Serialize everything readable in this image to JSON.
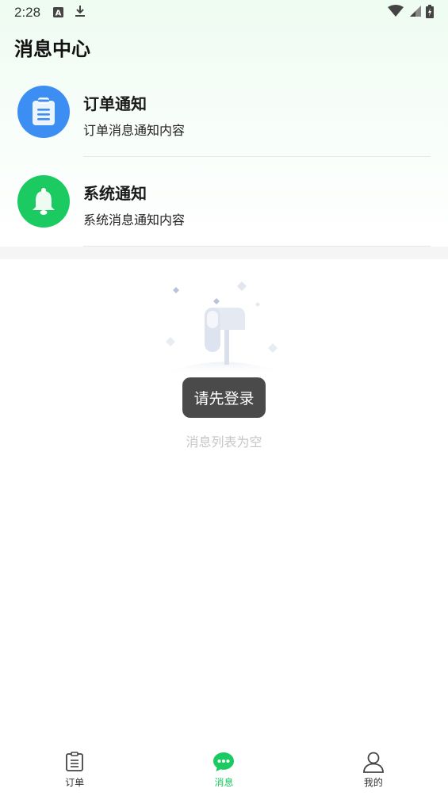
{
  "status_bar": {
    "time": "2:28",
    "left_icons": [
      "text-a-icon",
      "download-icon"
    ],
    "right_icons": [
      "wifi-icon",
      "signal-icon",
      "battery-icon"
    ]
  },
  "header": {
    "title": "消息中心"
  },
  "notices": [
    {
      "title": "订单通知",
      "description": "订单消息通知内容",
      "icon": "clipboard-icon",
      "color": "#3c8ef3"
    },
    {
      "title": "系统通知",
      "description": "系统消息通知内容",
      "icon": "bell-icon",
      "color": "#1bcb62"
    }
  ],
  "toast": {
    "text": "请先登录"
  },
  "empty_state": {
    "text": "消息列表为空",
    "icon": "mailbox-icon"
  },
  "tab_bar": {
    "active": 1,
    "accent_color": "#1bcb62",
    "tabs": [
      {
        "label": "订单",
        "icon": "order-list-icon"
      },
      {
        "label": "消息",
        "icon": "chat-bubble-icon"
      },
      {
        "label": "我的",
        "icon": "user-icon"
      }
    ]
  }
}
